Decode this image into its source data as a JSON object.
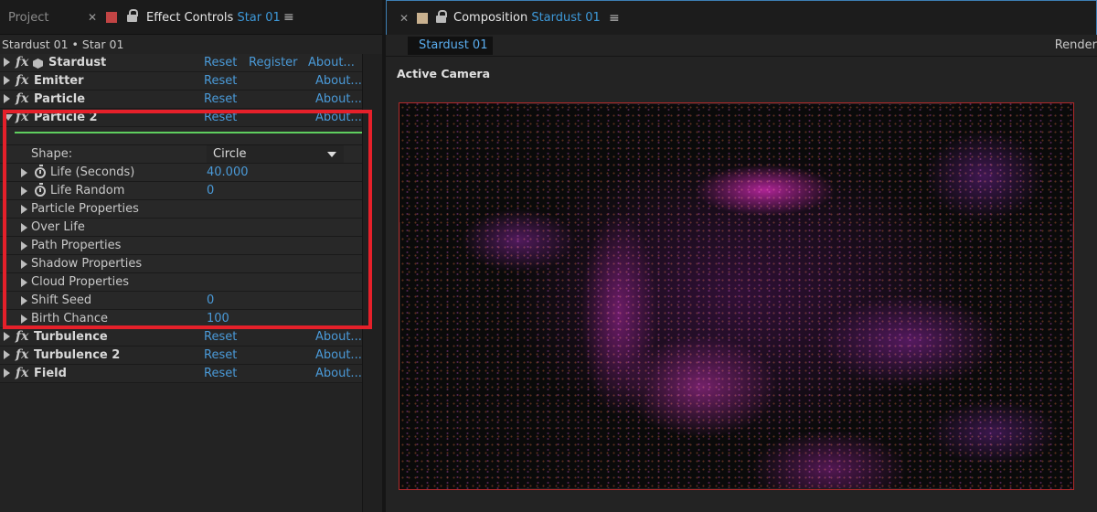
{
  "left_tabs": {
    "project": "Project",
    "effect_controls_label": "Effect Controls",
    "effect_controls_layer": "Star 01",
    "effect_swatch_color": "#c24444"
  },
  "breadcrumb": "Stardust 01 • Star 01",
  "effects": [
    {
      "name": "Stardust",
      "links": [
        "Reset",
        "Register",
        "About..."
      ]
    },
    {
      "name": "Emitter",
      "links": [
        "Reset",
        "About..."
      ]
    },
    {
      "name": "Particle",
      "links": [
        "Reset",
        "About..."
      ]
    },
    {
      "name": "Particle 2",
      "links": [
        "Reset",
        "About..."
      ]
    }
  ],
  "particle2": {
    "shape_label": "Shape:",
    "shape_value": "Circle",
    "properties": [
      {
        "label": "Life (Seconds)",
        "value": "40.000"
      },
      {
        "label": "Life Random",
        "value": "0"
      },
      {
        "label": "Particle Properties",
        "value": ""
      },
      {
        "label": "Over Life",
        "value": ""
      },
      {
        "label": "Path Properties",
        "value": ""
      },
      {
        "label": "Shadow Properties",
        "value": ""
      },
      {
        "label": "Cloud Properties",
        "value": ""
      },
      {
        "label": "Shift Seed",
        "value": "0"
      },
      {
        "label": "Birth Chance",
        "value": "100"
      }
    ]
  },
  "effects_after": [
    {
      "name": "Turbulence",
      "links": [
        "Reset",
        "About..."
      ]
    },
    {
      "name": "Turbulence 2",
      "links": [
        "Reset",
        "About..."
      ]
    },
    {
      "name": "Field",
      "links": [
        "Reset",
        "About..."
      ]
    }
  ],
  "composition": {
    "label": "Composition",
    "name": "Stardust 01",
    "swatch_color": "#c9b18f",
    "tab": "Stardust 01",
    "render": "Render",
    "view": "Active Camera"
  },
  "colors": {
    "accent_link": "#4a9ad8",
    "highlight_box": "#e5202a",
    "green_line": "#5fcf5f"
  }
}
